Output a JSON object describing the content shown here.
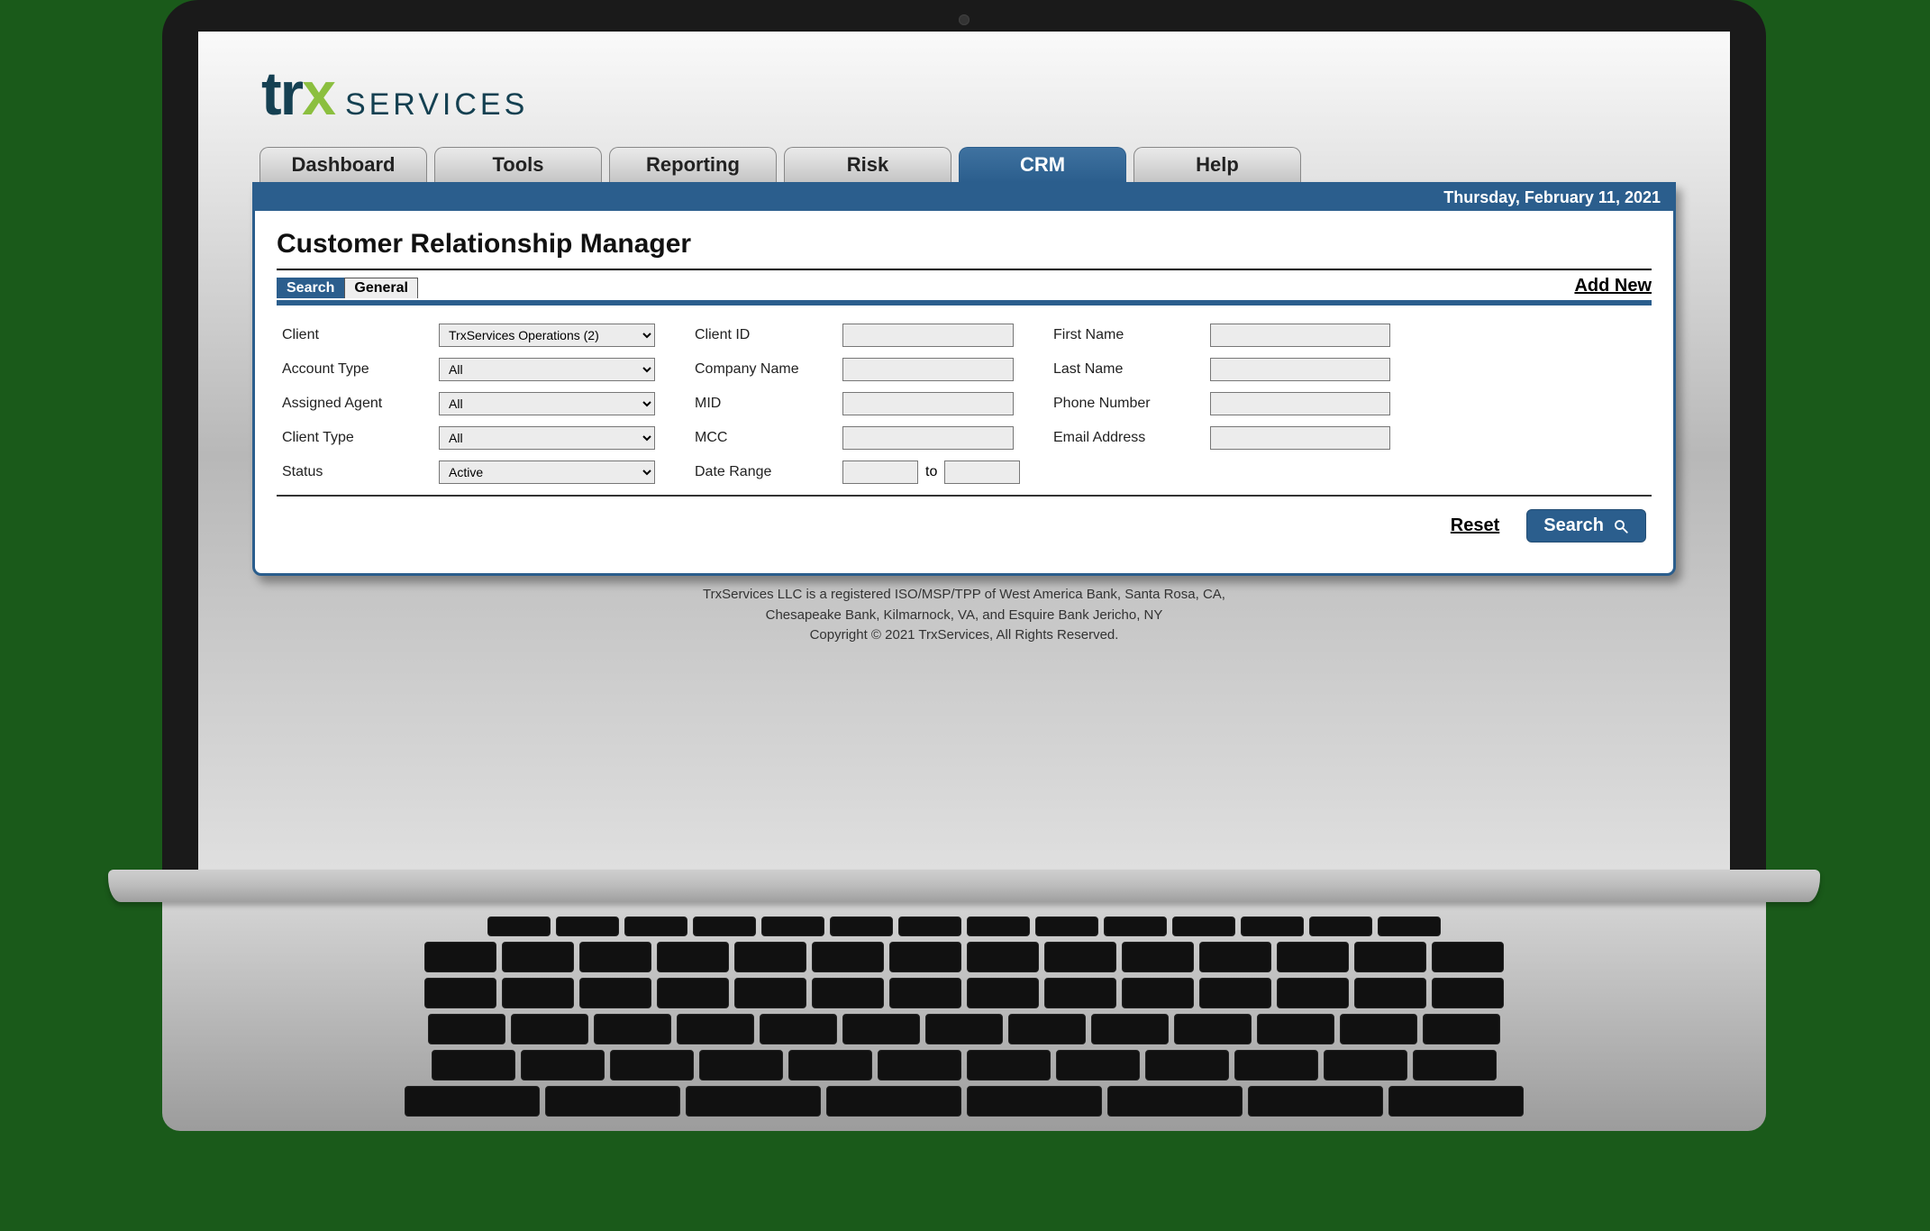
{
  "brand": {
    "trx": "trx",
    "services": "SERVICES"
  },
  "nav": {
    "tabs": [
      "Dashboard",
      "Tools",
      "Reporting",
      "Risk",
      "CRM",
      "Help"
    ],
    "active_index": 4
  },
  "header": {
    "date": "Thursday, February 11, 2021",
    "title": "Customer Relationship Manager"
  },
  "subtabs": {
    "items": [
      "Search",
      "General"
    ],
    "active_index": 0,
    "add_new": "Add New"
  },
  "form": {
    "left": {
      "client": {
        "label": "Client",
        "value": "TrxServices Operations (2)"
      },
      "account_type": {
        "label": "Account Type",
        "value": "All"
      },
      "assigned_agent": {
        "label": "Assigned Agent",
        "value": "All"
      },
      "client_type": {
        "label": "Client Type",
        "value": "All"
      },
      "status": {
        "label": "Status",
        "value": "Active"
      }
    },
    "mid": {
      "client_id": {
        "label": "Client ID",
        "value": ""
      },
      "company_name": {
        "label": "Company Name",
        "value": ""
      },
      "mid": {
        "label": "MID",
        "value": ""
      },
      "mcc": {
        "label": "MCC",
        "value": ""
      },
      "date_range": {
        "label": "Date Range",
        "from": "",
        "to_label": "to",
        "to": ""
      }
    },
    "right": {
      "first_name": {
        "label": "First Name",
        "value": ""
      },
      "last_name": {
        "label": "Last Name",
        "value": ""
      },
      "phone": {
        "label": "Phone Number",
        "value": ""
      },
      "email": {
        "label": "Email Address",
        "value": ""
      }
    }
  },
  "actions": {
    "reset": "Reset",
    "search": "Search"
  },
  "footer": {
    "line1": "TrxServices LLC is a registered ISO/MSP/TPP of West America Bank, Santa Rosa, CA,",
    "line2": "Chesapeake Bank, Kilmarnock, VA, and Esquire Bank Jericho, NY",
    "line3": "Copyright © 2021 TrxServices, All Rights Reserved."
  }
}
